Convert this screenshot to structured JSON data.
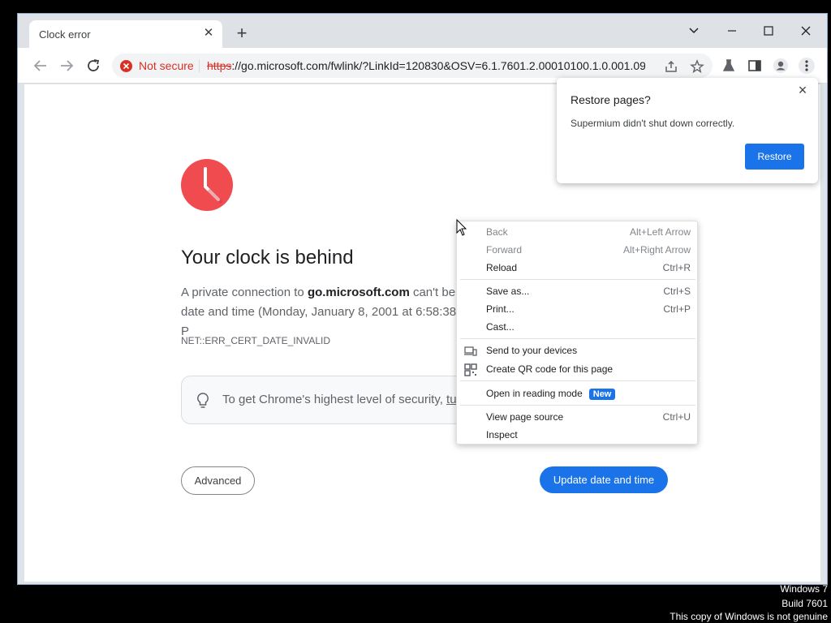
{
  "tab": {
    "title": "Clock error"
  },
  "address": {
    "security_label": "Not secure",
    "scheme": "https",
    "url_rest": "://go.microsoft.com/fwlink/?LinkId=120830&OSV=6.1.7601.2.00010100.1.0.001.09...."
  },
  "page": {
    "heading": "Your clock is behind",
    "desc_prefix": "A private connection to ",
    "desc_domain": "go.microsoft.com",
    "desc_mid": " can't be",
    "desc_line2": "date and time (Monday, January 8, 2001 at 6:58:38 P",
    "error_code": "NET::ERR_CERT_DATE_INVALID",
    "tip_text": "To get Chrome's highest level of security, ",
    "tip_link": "tur",
    "advanced_label": "Advanced",
    "update_label": "Update date and time"
  },
  "popup": {
    "title": "Restore pages?",
    "message": "Supermium didn't shut down correctly.",
    "restore_label": "Restore"
  },
  "menu": {
    "back": {
      "label": "Back",
      "shortcut": "Alt+Left Arrow"
    },
    "forward": {
      "label": "Forward",
      "shortcut": "Alt+Right Arrow"
    },
    "reload": {
      "label": "Reload",
      "shortcut": "Ctrl+R"
    },
    "save": {
      "label": "Save as...",
      "shortcut": "Ctrl+S"
    },
    "print": {
      "label": "Print...",
      "shortcut": "Ctrl+P"
    },
    "cast": {
      "label": "Cast..."
    },
    "send": {
      "label": "Send to your devices"
    },
    "qr": {
      "label": "Create QR code for this page"
    },
    "reading": {
      "label": "Open in reading mode",
      "badge": "New"
    },
    "source": {
      "label": "View page source",
      "shortcut": "Ctrl+U"
    },
    "inspect": {
      "label": "Inspect"
    }
  },
  "watermark": {
    "line1": "Windows 7",
    "line2": "Build 7601",
    "line3": "This copy of Windows is not genuine"
  },
  "colors": {
    "accent": "#1a73e8",
    "error": "#d93025",
    "clock": "#f04b4f"
  }
}
